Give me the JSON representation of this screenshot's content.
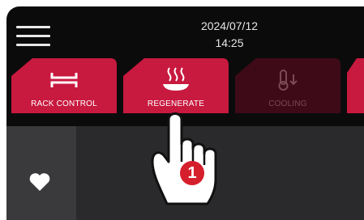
{
  "header": {
    "date": "2024/07/12",
    "time": "14:25"
  },
  "tabs": [
    {
      "label": "RACK CONTROL",
      "icon": "rack-icon",
      "state": "active"
    },
    {
      "label": "REGENERATE",
      "icon": "steam-plate-icon",
      "state": "active"
    },
    {
      "label": "COOLING",
      "icon": "thermometer-down-icon",
      "state": "inactive"
    }
  ],
  "sidebar": {
    "favorite_icon": "heart-icon"
  },
  "overlay": {
    "step_number": "1",
    "gesture_icon": "pointing-hand-icon"
  },
  "colors": {
    "accent": "#c8193f",
    "inactive": "#3e0a18",
    "background": "#0b0b0c"
  }
}
